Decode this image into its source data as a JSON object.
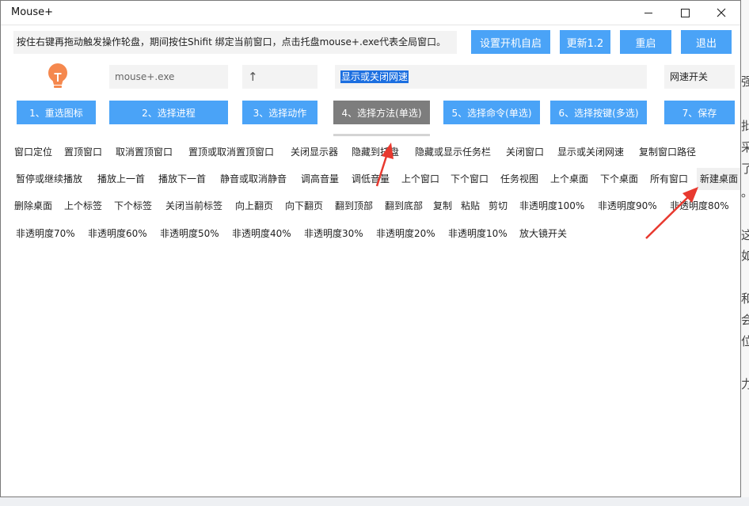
{
  "window": {
    "title": "Mouse+",
    "controls": {
      "minimize": "minimize",
      "maximize": "maximize",
      "close": "close"
    }
  },
  "toolbar": {
    "info": "按住右键再拖动触发操作轮盘，期间按住Shifit 绑定当前窗口，点击托盘mouse+.exe代表全局窗口。",
    "autostart_label": "设置开机自启",
    "update_label": "更新1.2",
    "restart_label": "重启",
    "exit_label": "退出"
  },
  "fields": {
    "process": "mouse+.exe",
    "action": "↑",
    "method_selected": "显示或关闭网速",
    "command": "网速开关"
  },
  "steps": [
    {
      "label": "1、重选图标"
    },
    {
      "label": "2、选择进程"
    },
    {
      "label": "3、选择动作"
    },
    {
      "label": "4、选择方法(单选)"
    },
    {
      "label": "5、选择命令(单选)"
    },
    {
      "label": "6、选择按键(多选)"
    },
    {
      "label": "7、保存"
    }
  ],
  "options": [
    "窗口定位",
    "置顶窗口",
    "取消置顶窗口",
    "置顶或取消置顶窗口",
    "关闭显示器",
    "隐藏到托盘",
    "隐藏或显示任务栏",
    "关闭窗口",
    "显示或关闭网速",
    "复制窗口路径",
    "暂停或继续播放",
    "播放上一首",
    "播放下一首",
    "静音或取消静音",
    "调高音量",
    "调低音量",
    "上个窗口",
    "下个窗口",
    "任务视图",
    "上个桌面",
    "下个桌面",
    "所有窗口",
    "新建桌面",
    "删除桌面",
    "上个标签",
    "下个标签",
    "关闭当前标签",
    "向上翻页",
    "向下翻页",
    "翻到顶部",
    "翻到底部",
    "复制",
    "粘贴",
    "剪切",
    "非透明度100%",
    "非透明度90%",
    "非透明度80%",
    "非透明度70%",
    "非透明度60%",
    "非透明度50%",
    "非透明度40%",
    "非透明度30%",
    "非透明度20%",
    "非透明度10%",
    "放大镜开关"
  ],
  "background_glyphs": [
    "强",
    "批",
    "采",
    "了",
    "。",
    "这",
    "如",
    "和",
    "会",
    "位",
    "力"
  ],
  "colors": {
    "button_blue": "#4aa3f7",
    "active_step_gray": "#7d7d7d",
    "annotation_red": "#e8392f",
    "bulb_orange": "#f5884e",
    "selection_blue": "#1c6fe0"
  }
}
